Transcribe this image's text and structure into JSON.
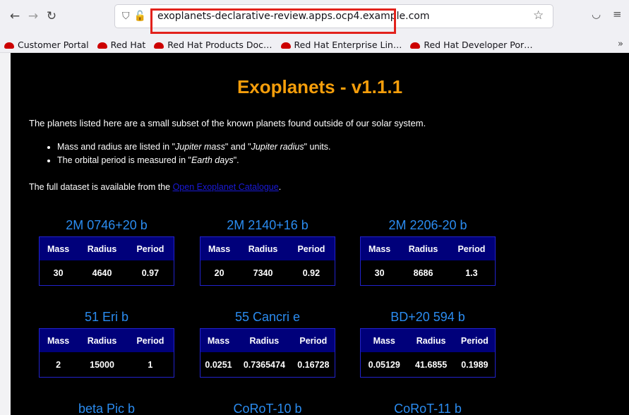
{
  "browser": {
    "url": "exoplanets-declarative-review.apps.ocp4.example.com",
    "icons": {
      "back": "back-arrow-icon",
      "forward": "forward-arrow-icon",
      "reload": "reload-icon",
      "shield": "tracking-shield-icon",
      "lock": "connection-icon",
      "star": "bookmark-star-icon",
      "pocket": "pocket-icon",
      "menu": "hamburger-menu-icon"
    },
    "bookmarks": [
      "Customer Portal",
      "Red Hat",
      "Red Hat Products Doc…",
      "Red Hat Enterprise Lin…",
      "Red Hat Developer Por…"
    ]
  },
  "page": {
    "title": "Exoplanets - v1.1.1",
    "intro": "The planets listed here are a small subset of the known planets found outside of our solar system.",
    "bullet1_pre": "Mass and radius are listed in \"",
    "bullet1_em1": "Jupiter mass",
    "bullet1_mid": "\" and \"",
    "bullet1_em2": "Jupiter radius",
    "bullet1_post": "\" units.",
    "bullet2_pre": "The orbital period is measured in \"",
    "bullet2_em": "Earth days",
    "bullet2_post": "\".",
    "dataset_pre": "The full dataset is available from the ",
    "dataset_link": "Open Exoplanet Catalogue",
    "dataset_post": ".",
    "headers": {
      "mass": "Mass",
      "radius": "Radius",
      "period": "Period"
    },
    "planets": [
      {
        "name": "2M 0746+20 b",
        "mass": "30",
        "radius": "4640",
        "period": "0.97"
      },
      {
        "name": "2M 2140+16 b",
        "mass": "20",
        "radius": "7340",
        "period": "0.92"
      },
      {
        "name": "2M 2206-20 b",
        "mass": "30",
        "radius": "8686",
        "period": "1.3"
      },
      {
        "name": "51 Eri b",
        "mass": "2",
        "radius": "15000",
        "period": "1"
      },
      {
        "name": "55 Cancri e",
        "mass": "0.0251",
        "radius": "0.7365474",
        "period": "0.16728"
      },
      {
        "name": "BD+20 594 b",
        "mass": "0.05129",
        "radius": "41.6855",
        "period": "0.1989"
      }
    ],
    "partial_planets": [
      "beta Pic b",
      "CoRoT-10 b",
      "CoRoT-11 b"
    ]
  },
  "colors": {
    "title": "#f59e0b",
    "planet_name": "#2b8cf0",
    "table_header": "#00007a",
    "link": "#1a1ad8",
    "highlight": "#e2221c"
  }
}
